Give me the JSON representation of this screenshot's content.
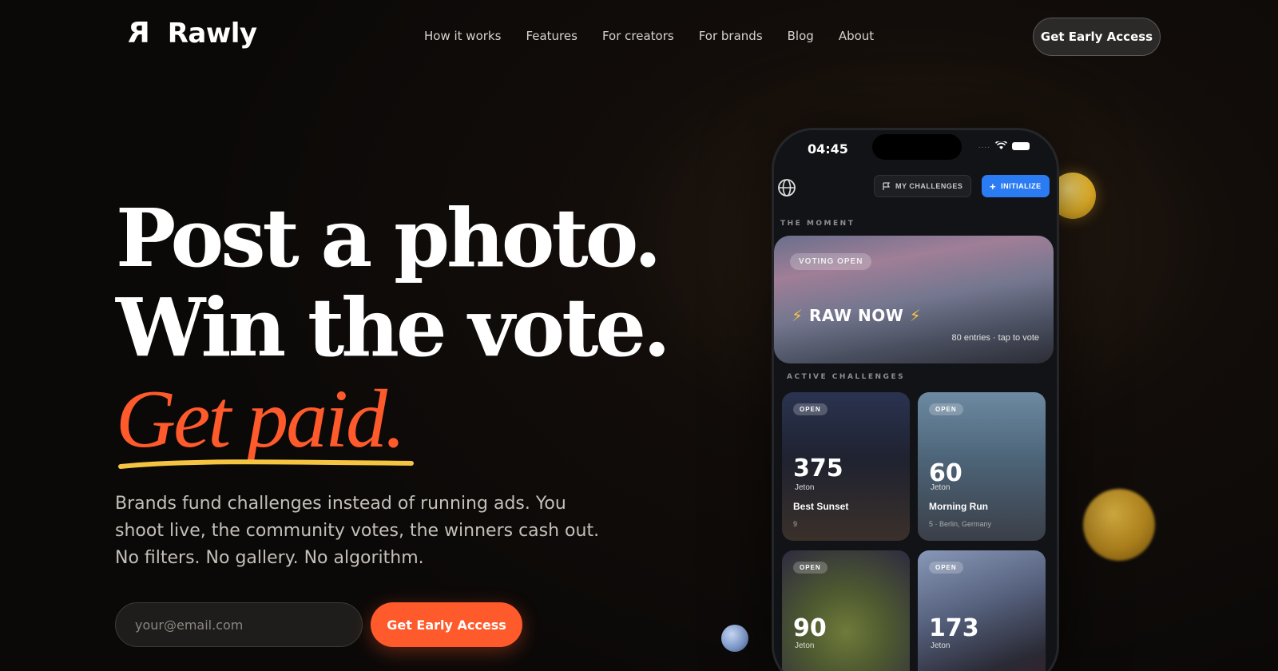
{
  "brand": {
    "mark": "R",
    "name": "Rawly"
  },
  "nav": {
    "links": [
      "How it works",
      "Features",
      "For creators",
      "For brands",
      "Blog",
      "About"
    ],
    "cta": "Get Early Access"
  },
  "hero": {
    "line1": "Post a photo.",
    "line2": "Win the vote.",
    "line3": "Get paid.",
    "subcopy": "Brands fund challenges instead of running ads. You shoot live, the community votes, the winners cash out. No filters. No gallery. No algorithm.",
    "email_placeholder": "your@email.com",
    "cta": "Get Early Access"
  },
  "phone": {
    "time": "04:45",
    "signal": "....",
    "my_challenges": "MY CHALLENGES",
    "initialize": "INITIALIZE",
    "moment_label": "THE MOMENT",
    "moment": {
      "pill": "VOTING OPEN",
      "title": "RAW NOW",
      "entries": "80 entries · tap to vote"
    },
    "active_label": "ACTIVE CHALLENGES",
    "challenges": [
      {
        "status": "OPEN",
        "count": "375",
        "unit": "Jeton",
        "name": "Best Sunset",
        "meta": "9"
      },
      {
        "status": "OPEN",
        "count": "60",
        "unit": "Jeton",
        "name": "Morning Run",
        "meta": "5 · Berlin, Germany"
      },
      {
        "status": "OPEN",
        "count": "90",
        "unit": "Jeton"
      },
      {
        "status": "OPEN",
        "count": "173",
        "unit": "Jeton"
      }
    ]
  },
  "colors": {
    "accent": "#ff5a2b",
    "underline": "#f5c542",
    "blue": "#2b7bf2"
  }
}
